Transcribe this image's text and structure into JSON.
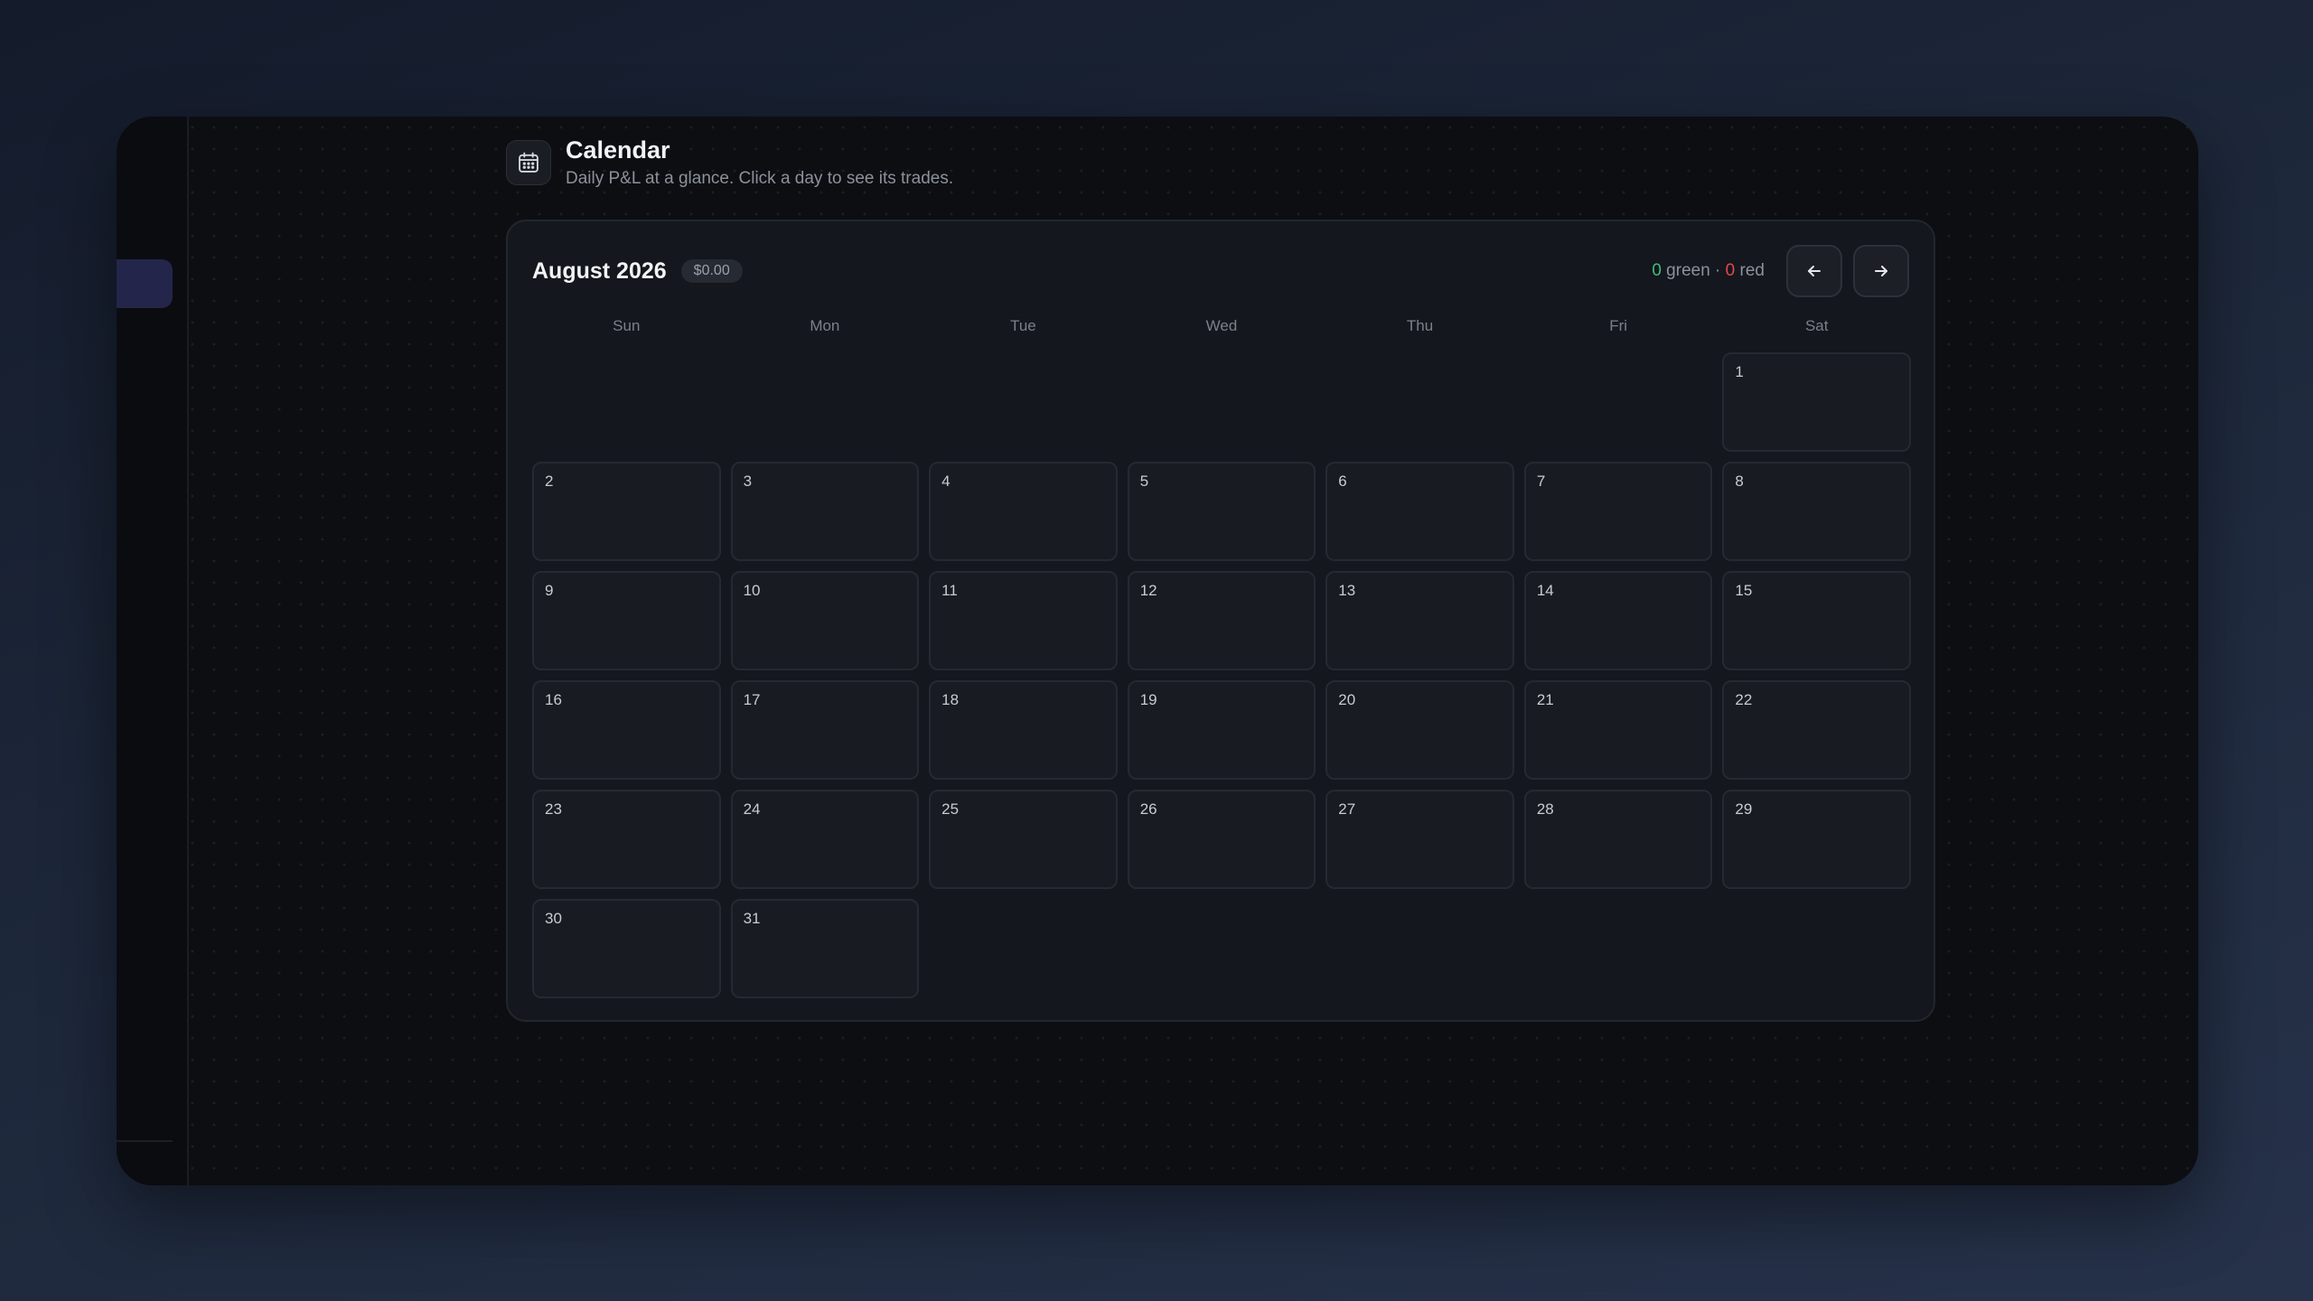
{
  "header": {
    "icon": "calendar-icon",
    "title": "Calendar",
    "subtitle": "Daily P&L at a glance. Click a day to see its trades."
  },
  "calendar": {
    "month_label": "August 2026",
    "total_badge": "$0.00",
    "summary": {
      "green_count": "0",
      "green_label": " green · ",
      "red_count": "0",
      "red_label": " red"
    },
    "prev_icon": "arrow-left-icon",
    "next_icon": "arrow-right-icon",
    "weekdays": [
      "Sun",
      "Mon",
      "Tue",
      "Wed",
      "Thu",
      "Fri",
      "Sat"
    ],
    "first_weekday_index": 6,
    "days": [
      "1",
      "2",
      "3",
      "4",
      "5",
      "6",
      "7",
      "8",
      "9",
      "10",
      "11",
      "12",
      "13",
      "14",
      "15",
      "16",
      "17",
      "18",
      "19",
      "20",
      "21",
      "22",
      "23",
      "24",
      "25",
      "26",
      "27",
      "28",
      "29",
      "30",
      "31"
    ]
  },
  "colors": {
    "green": "#3fbf7f",
    "red": "#e5484d",
    "sidebar_active": "#24254a"
  }
}
